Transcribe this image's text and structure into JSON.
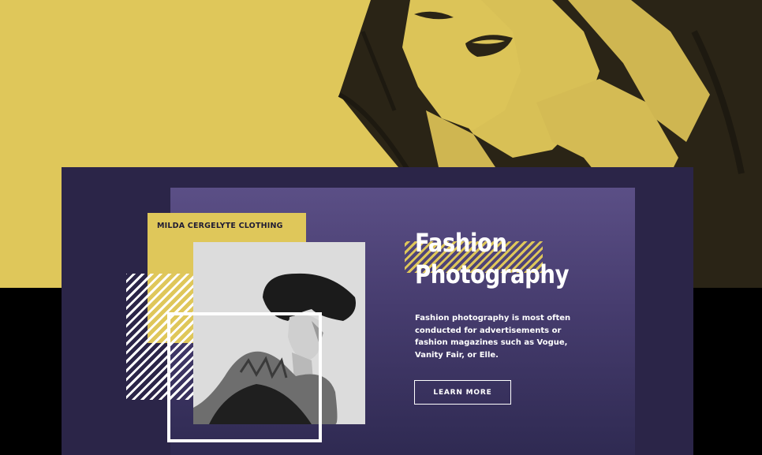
{
  "hero": {
    "background_color": "#dfc75a",
    "image": "woman-portrait-duotone"
  },
  "card": {
    "background_color": "#2b2548",
    "label": "MILDA CERGELYTE CLOTHING",
    "title_line1": "Fashion",
    "title_line2": "Photography",
    "description": "Fashion photography is most often conducted for advertisements or fashion magazines such as Vogue, Vanity Fair, or Elle.",
    "button_label": "LEARN MORE",
    "photo": "model-portrait-bw"
  },
  "colors": {
    "accent_yellow": "#dfc75a",
    "navy": "#2b2548",
    "purple": "#5b4f86",
    "black": "#000000",
    "white": "#ffffff"
  }
}
